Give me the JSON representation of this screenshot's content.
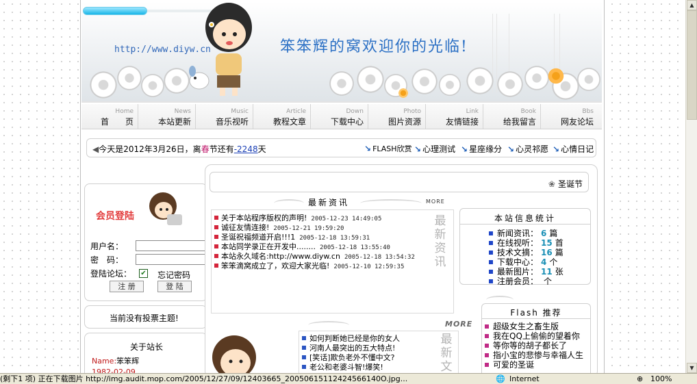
{
  "banner": {
    "url": "http://www.diyw.cn",
    "welcome": "笨笨辉的窝欢迎你的光临!"
  },
  "nav": [
    {
      "en": "Home",
      "zh": "首　　页"
    },
    {
      "en": "News",
      "zh": "本站更新"
    },
    {
      "en": "Music",
      "zh": "音乐视听"
    },
    {
      "en": "Article",
      "zh": "教程文章"
    },
    {
      "en": "Down",
      "zh": "下载中心"
    },
    {
      "en": "Photo",
      "zh": "图片资源"
    },
    {
      "en": "Link",
      "zh": "友情链接"
    },
    {
      "en": "Book",
      "zh": "给我留言"
    },
    {
      "en": "Bbs",
      "zh": "网友论坛"
    }
  ],
  "ticker": {
    "prefix": "今天是2012年3月26日，离",
    "festival": "春",
    "middle": "节还有",
    "days": "-2248",
    "suffix": "天",
    "links": [
      "FLASH欣赏",
      "心理测试",
      "星座缘分",
      "心灵祁愿",
      "心情日记"
    ]
  },
  "login": {
    "title": "会员登陆",
    "username_label": "用户名：",
    "password_label": "密　码：",
    "forum_label": "登陆论坛：",
    "remember_label": "忘记密码",
    "register_button": "注 册",
    "login_button": "登 陆"
  },
  "vote": {
    "text": "当前没有投票主题!"
  },
  "about": {
    "title": "关于站长",
    "name_label": "Name:",
    "name_value": "笨笨辉",
    "second_line": "1982-02-09"
  },
  "center": {
    "christmas": "圣诞节",
    "news_heading": "最新资讯",
    "more": "MORE",
    "news_vertical": [
      "最",
      "新",
      "资",
      "讯"
    ],
    "news": [
      {
        "title": "关于本站程序版权的声明!",
        "date": "2005-12-23 14:49:05"
      },
      {
        "title": "诚征友情连接!",
        "date": "2005-12-21 19:59:20"
      },
      {
        "title": "圣诞祝福频道开启!!!1",
        "date": "2005-12-18 13:59:31"
      },
      {
        "title": "本站同学录正在开发中........",
        "date": "2005-12-18 13:55:40"
      },
      {
        "title": "本站永久域名:http://www.diyw.cn",
        "date": "2005-12-18 13:54:32"
      },
      {
        "title": "笨笨滴窝成立了，欢迎大家光临!",
        "date": "2005-12-10 12:59:35"
      }
    ],
    "more2": "MORE",
    "articles": [
      "如何判断她已经是你的女人",
      "河南人最突出的五大特点!",
      "[笑话]欺负老外不懂中文?",
      "老公和老婆斗智!爆笑!"
    ],
    "articles_vertical": [
      "最",
      "新",
      "文"
    ]
  },
  "stats": {
    "title": "本站信息统计",
    "rows": [
      {
        "label": "新闻资讯：",
        "value": "6",
        "unit": "篇"
      },
      {
        "label": "在线视听：",
        "value": "15",
        "unit": "首"
      },
      {
        "label": "技术文摘：",
        "value": "16",
        "unit": "篇"
      },
      {
        "label": "下载中心：",
        "value": "4",
        "unit": "个"
      },
      {
        "label": "最新图片：",
        "value": "11",
        "unit": "张"
      },
      {
        "label": "注册会员：",
        "value": "",
        "unit": "个"
      }
    ]
  },
  "flash": {
    "title": "Flash 推荐",
    "items": [
      "超级女生之畜生版",
      "我在QQ上偷偷的望着你",
      "等你等的胡子都长了",
      "指小宝的悲惨与幸福人生",
      "可爱的圣诞"
    ]
  },
  "statusbar": {
    "text": "(剩下1 项) 正在下载图片 http://img.audit.mop.com/2005/12/27/09/12403665_20050615112424566140O.jpg...",
    "zone": "Internet",
    "zoom": "100%"
  },
  "colors": {
    "accent": "#2a6fc4",
    "news_bullet": "#d4243a",
    "stat_value": "#1a8fb5",
    "flash_bullet": "#c02a86"
  }
}
